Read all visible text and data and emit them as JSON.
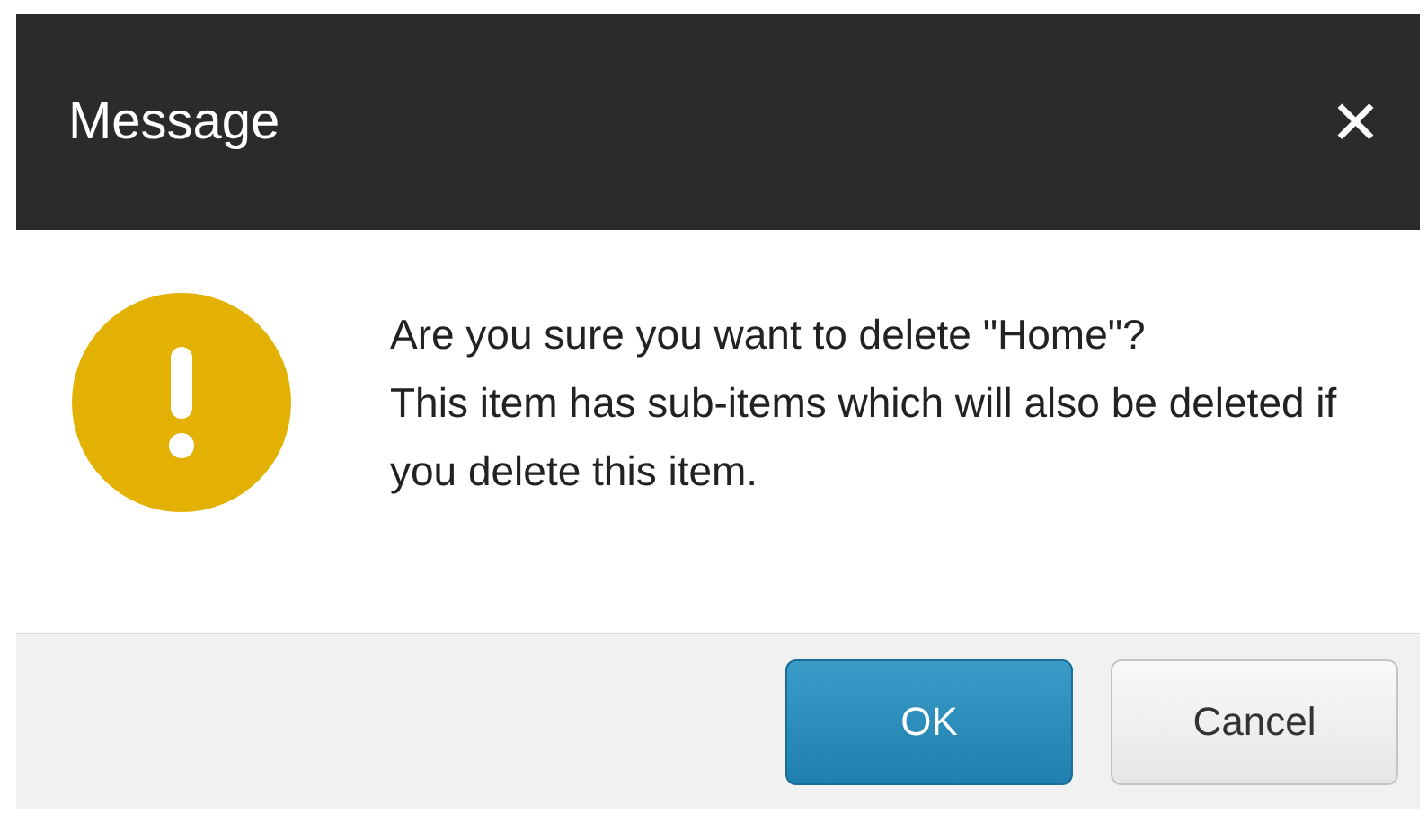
{
  "dialog": {
    "title": "Message",
    "close_glyph": "✕",
    "message": "Are you sure you want to delete \"Home\"?\nThis item has sub-items which will also be deleted if you delete this item.",
    "buttons": [
      {
        "label": "OK",
        "kind": "primary"
      },
      {
        "label": "Cancel",
        "kind": "secondary"
      }
    ]
  }
}
